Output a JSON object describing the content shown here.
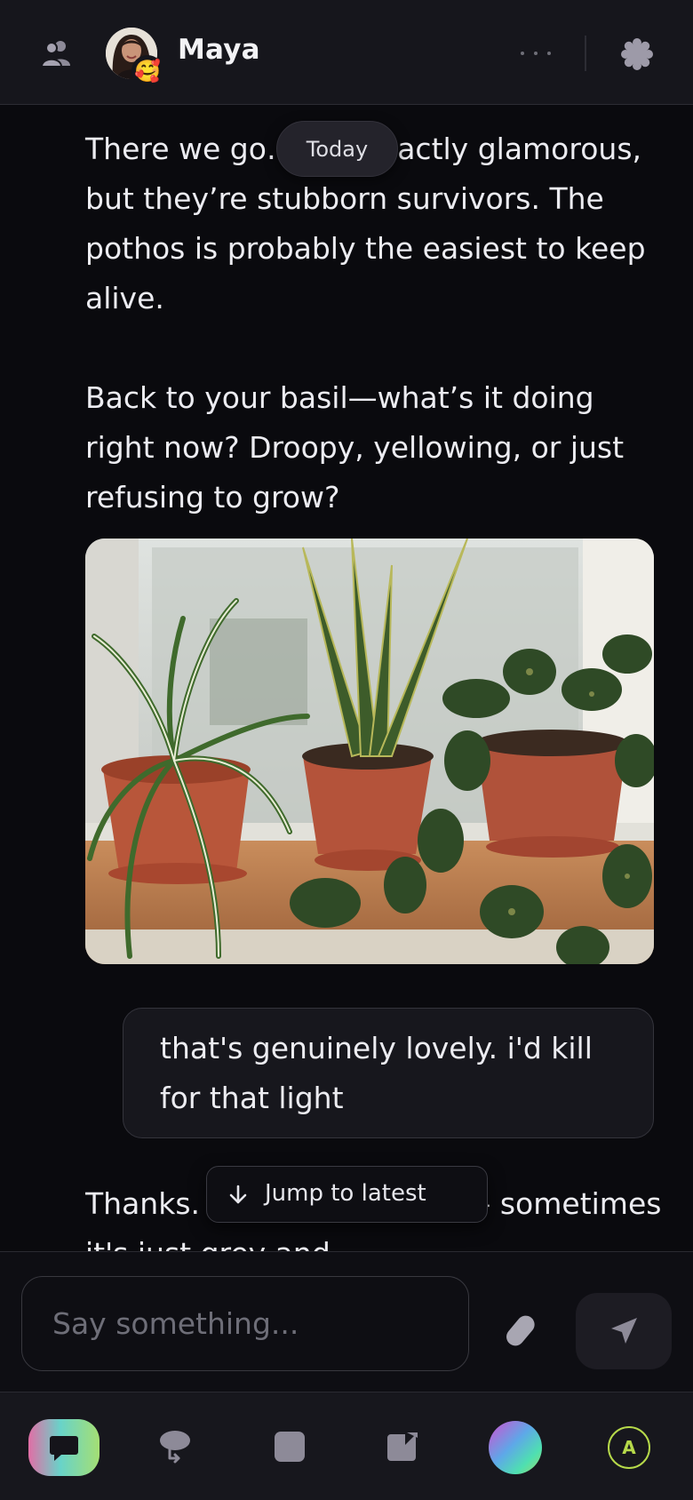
{
  "header": {
    "contact_name": "Maya",
    "avatar_emoji": "🥰",
    "icons": {
      "left": "people-icon",
      "more": "more-dots-icon",
      "settings": "gear-icon"
    }
  },
  "conversation": {
    "date_separator": "Today",
    "ai_message_1": {
      "paragraph_1": "There we go… not exactly glamorous, but they’re stubborn survivors. The pothos is probably the easiest to keep alive.",
      "paragraph_2": "Back to your basil—what’s it doing right now? Droopy, yellowing, or just refusing to grow?"
    },
    "user_message": "that's genuinely lovely. i'd kill for that light",
    "ai_message_2_partial": "Thanks. It's… kind of nice— sometimes it's just grey and"
  },
  "jump_to_latest": {
    "label": "Jump to latest",
    "icon": "arrow-down-icon"
  },
  "composer": {
    "placeholder": "Say something...",
    "value": "",
    "attach_icon": "paperclip-icon",
    "send_icon": "send-icon"
  },
  "bottom_nav": {
    "items": [
      "chat-icon",
      "memories-icon",
      "notes-icon",
      "compose-icon",
      "orb-icon",
      "account-avatar"
    ],
    "account_initial": "A"
  },
  "colors": {
    "background": "#0a0a0e",
    "header": "#16161c",
    "bubble": "#17171d",
    "text": "#ececf1",
    "muted_icon": "#9d9aa8",
    "account_accent": "#b6d94a"
  }
}
